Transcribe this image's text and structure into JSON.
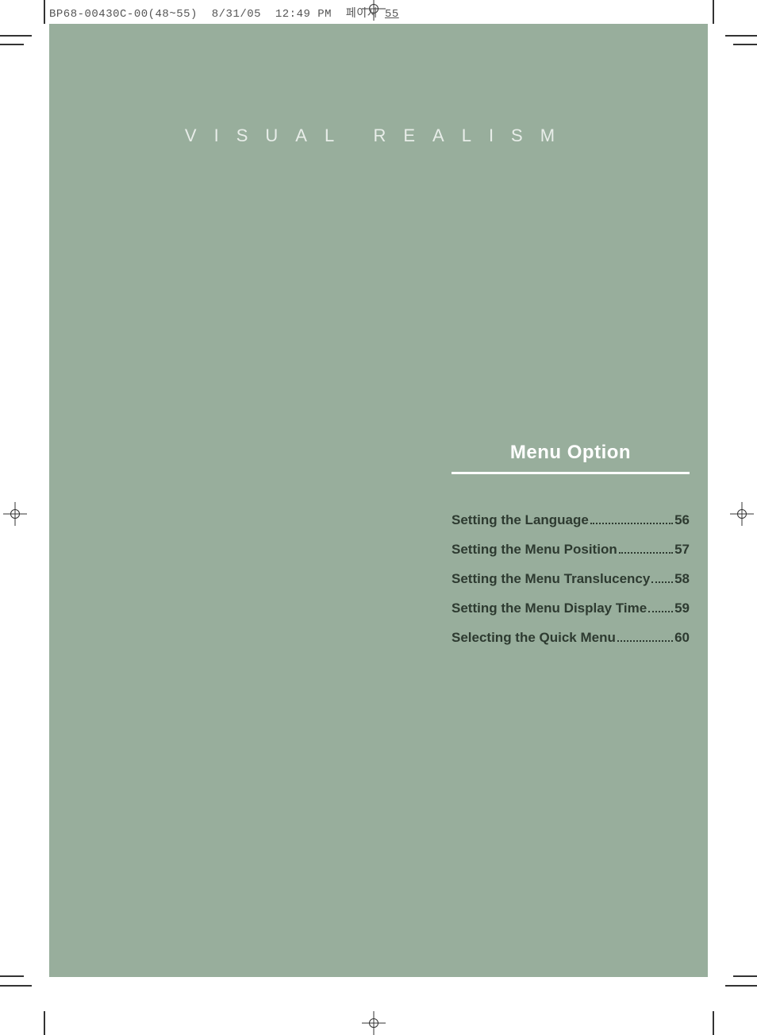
{
  "header": {
    "doc_id": "BP68-00430C-00(48~55)",
    "date": "8/31/05",
    "time": "12:49 PM",
    "page_label": "페이지",
    "page_number": "55"
  },
  "section_title": "VISUAL REALISM",
  "menu": {
    "heading": "Menu Option",
    "items": [
      {
        "label": "Setting the Language",
        "page": "56"
      },
      {
        "label": "Setting the Menu Position",
        "page": "57"
      },
      {
        "label": "Setting the Menu Translucency",
        "page": "58"
      },
      {
        "label": "Setting the Menu Display Time",
        "page": "59"
      },
      {
        "label": "Selecting the Quick Menu",
        "page": "60"
      }
    ]
  }
}
